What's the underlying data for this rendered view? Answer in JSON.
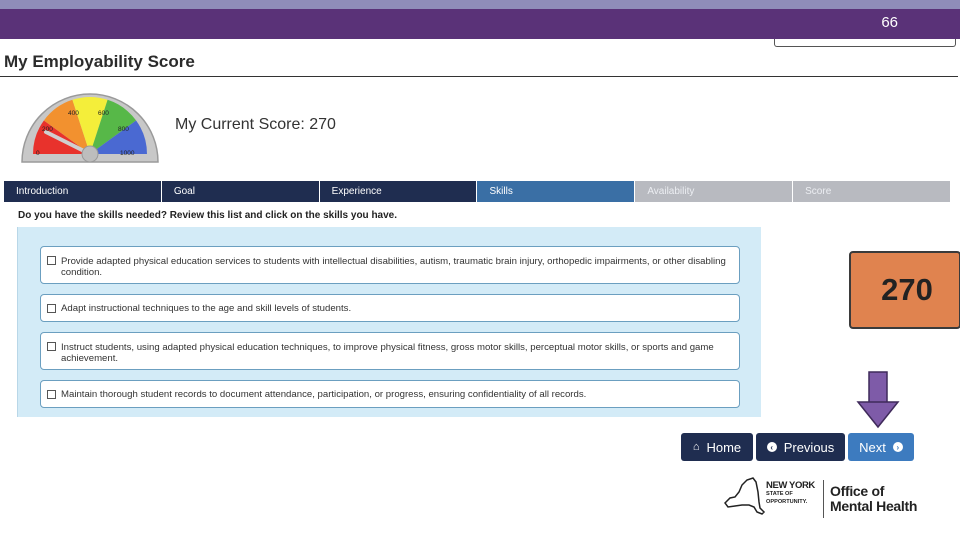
{
  "slide": {
    "page_number": "66"
  },
  "app": {
    "title": "My Employability Score"
  },
  "gauge": {
    "labels": [
      "0",
      "200",
      "400",
      "600",
      "800",
      "1000"
    ],
    "needle_value": 270,
    "colors": {
      "red": "#e8322c",
      "orange": "#f2912f",
      "yellow": "#f4ee3a",
      "green": "#57b848",
      "blue": "#4a69d2"
    }
  },
  "score": {
    "label": "My Current Score: 270",
    "callout_value": "270"
  },
  "tabs": [
    {
      "label": "Introduction",
      "state": "done"
    },
    {
      "label": "Goal",
      "state": "done"
    },
    {
      "label": "Experience",
      "state": "done"
    },
    {
      "label": "Skills",
      "state": "active"
    },
    {
      "label": "Availability",
      "state": "pending"
    },
    {
      "label": "Score",
      "state": "pending"
    }
  ],
  "question": "Do you have the skills needed? Review this list and click on the skills you have.",
  "skills": [
    {
      "text": "Provide adapted physical education services to students with intellectual disabilities, autism, traumatic brain injury, orthopedic impairments, or other disabling condition.",
      "checked": false
    },
    {
      "text": "Adapt instructional techniques to the age and skill levels of students.",
      "checked": false
    },
    {
      "text": "Instruct students, using adapted physical education techniques, to improve physical fitness, gross motor skills, perceptual motor skills, or sports and game achievement.",
      "checked": false
    },
    {
      "text": "Maintain thorough student records to document attendance, participation, or progress, ensuring confidentiality of all records.",
      "checked": false
    }
  ],
  "nav": {
    "home": "Home",
    "previous": "Previous",
    "next": "Next"
  },
  "logo": {
    "ny_line1": "NEW YORK",
    "ny_line2": "STATE OF",
    "ny_line3": "OPPORTUNITY.",
    "omh_line1": "Office of",
    "omh_line2": "Mental Health"
  },
  "colors": {
    "header_purple": "#5a3278",
    "tab_navy": "#1f2d50",
    "tab_active": "#3a6fa5",
    "callout_orange": "#e0834f",
    "arrow_purple": "#7e5ba8"
  }
}
